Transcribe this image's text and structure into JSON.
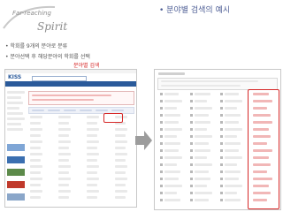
{
  "logo": {
    "line1": "Far-reaching",
    "line2": "Spirit"
  },
  "slide": {
    "title": "• 분야별 검색의 예시",
    "bullets": [
      "• 학회를 9개의 분야로 분류",
      "• 분야선택 후 해당분야의 학회를 선택"
    ],
    "annotation": "분야별 검색"
  },
  "left_screenshot": {
    "site_logo": "KISS"
  },
  "colors": {
    "accent": "#d62828",
    "title": "#4f5f96",
    "banner": "#2a5a9a",
    "arrow": "#9c9c9c"
  }
}
